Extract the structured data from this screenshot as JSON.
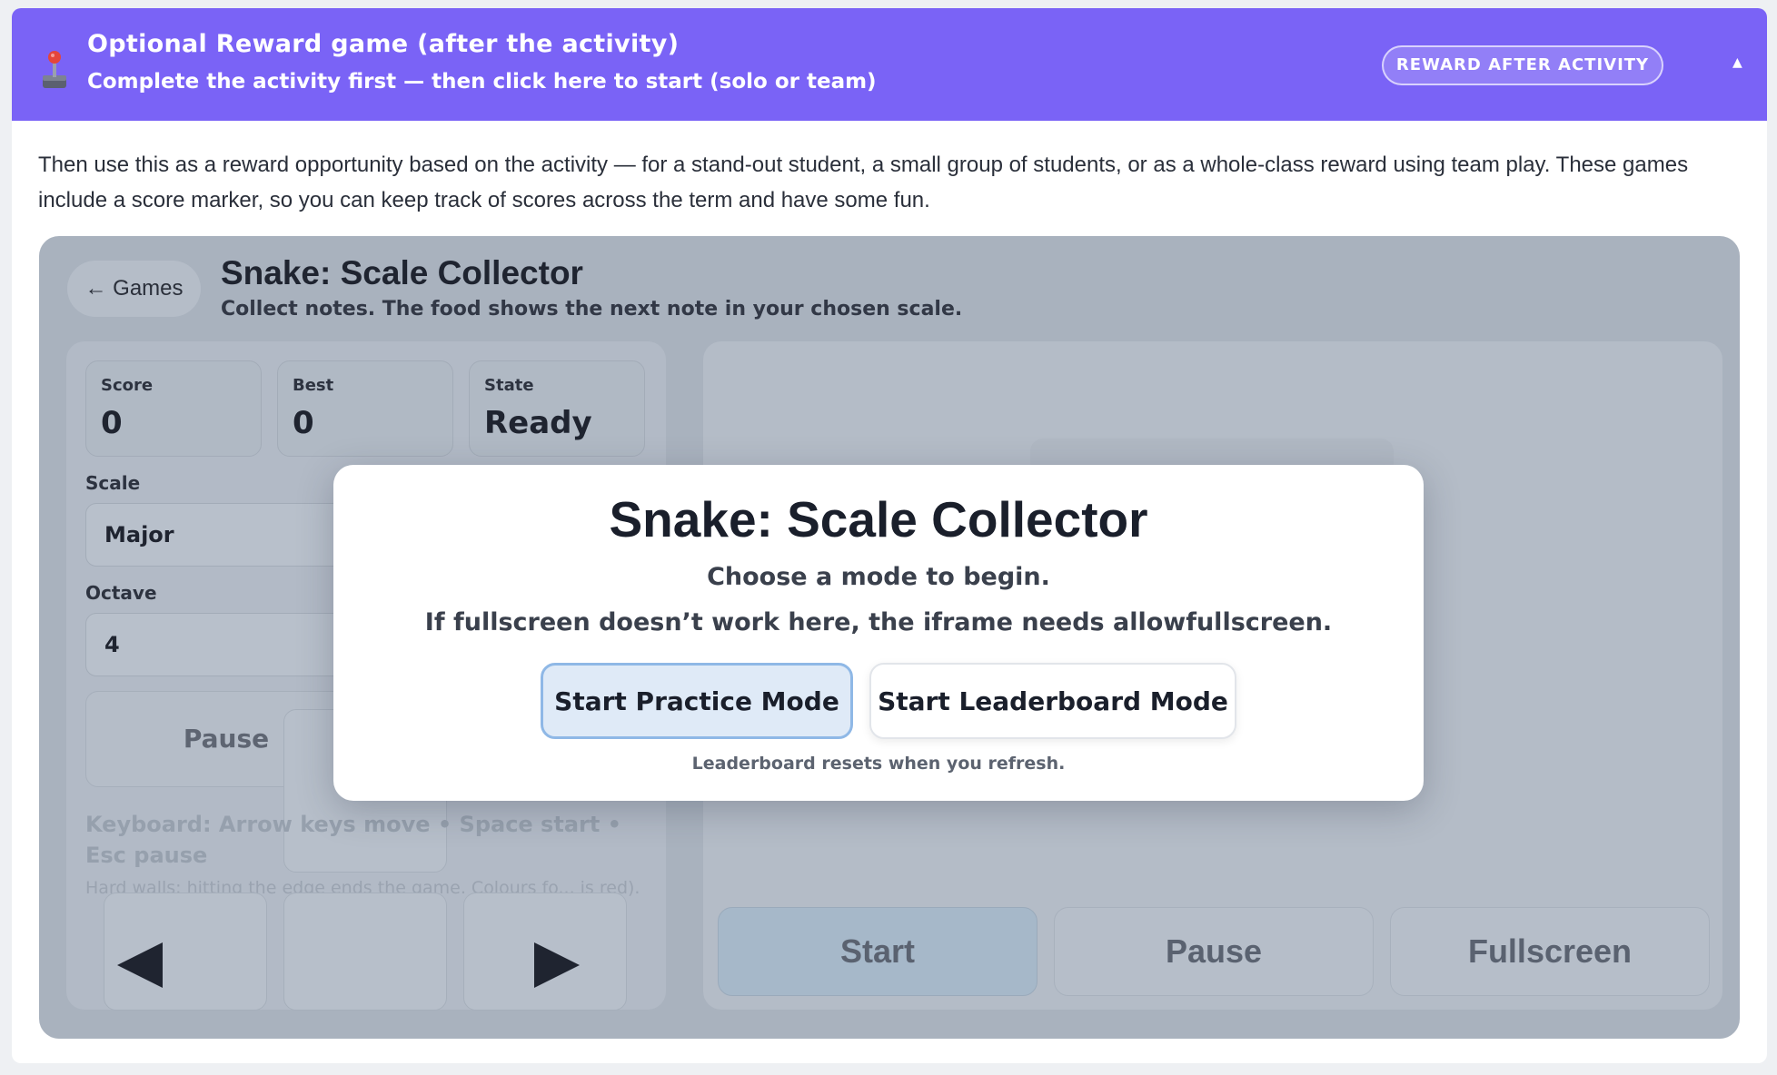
{
  "banner": {
    "title": "Optional Reward game (after the activity)",
    "subtitle": "Complete the activity first — then click here to start (solo or team)",
    "pill_label": "REWARD AFTER ACTIVITY",
    "collapse_glyph": "▲",
    "icon": "joystick-icon"
  },
  "description": "Then use this as a reward opportunity based on the activity — for a stand-out student, a small group of students, or as a whole-class reward using team play. These games include a score marker, so you can keep track of scores across the term and have some fun.",
  "game": {
    "back_label": "← Games",
    "title": "Snake: Scale Collector",
    "subtitle": "Collect notes. The food shows the next note in your chosen scale.",
    "stats": {
      "score_label": "Score",
      "score_value": "0",
      "best_label": "Best",
      "best_value": "0",
      "state_label": "State",
      "state_value": "Ready"
    },
    "scale_label": "Scale",
    "scale_value": "Major",
    "octave_label": "Octave",
    "octave_value": "4",
    "pause_label": "Pause",
    "keyboard_hint": "Keyboard: Arrow keys move • Space start • Esc pause",
    "walls_hint": "Hard walls: hitting the edge ends the game. Colours fo... is red).",
    "controls": {
      "start": "Start",
      "pause": "Pause",
      "fullscreen": "Fullscreen"
    }
  },
  "modal": {
    "title": "Snake: Scale Collector",
    "line1": "Choose a mode to begin.",
    "line2": "If fullscreen doesn’t work here, the iframe needs allowfullscreen.",
    "practice_label": "Start Practice Mode",
    "leaderboard_label": "Start Leaderboard Mode",
    "note": "Leaderboard resets when you refresh."
  },
  "colors": {
    "banner": "#7a63f6",
    "overlay": "#a9b2be",
    "practice_button": "#dfeaf7"
  }
}
